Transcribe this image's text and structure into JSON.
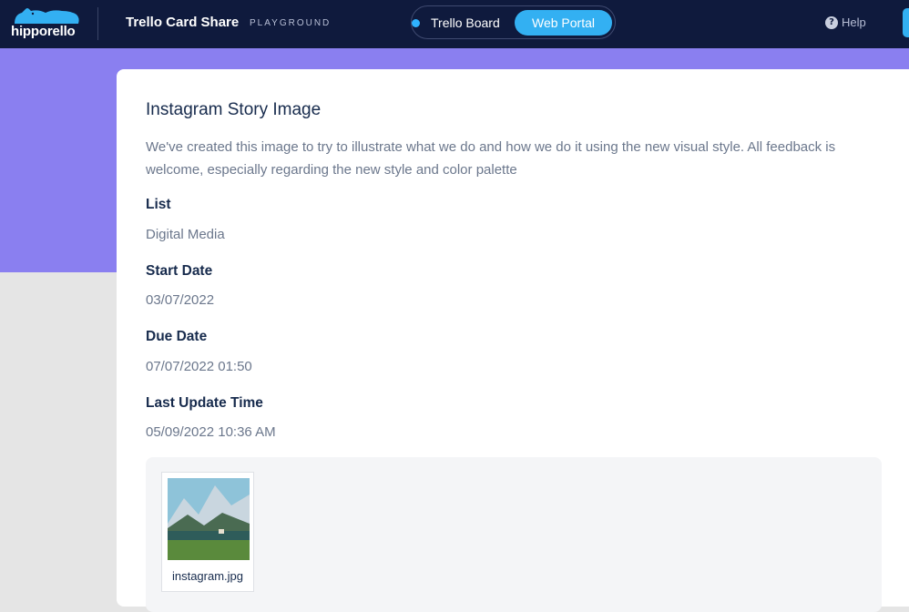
{
  "topbar": {
    "logo_text": "hipporello",
    "app_title": "Trello Card Share",
    "app_subtitle": "PLAYGROUND",
    "toggle": {
      "board_label": "Trello Board",
      "portal_label": "Web Portal",
      "active": "Web Portal"
    },
    "help_label": "Help",
    "icons": {
      "logo": "hippo-logo-icon",
      "help": "help-circle-icon",
      "toggle_dot": "status-dot-icon"
    }
  },
  "card": {
    "title": "Instagram Story Image",
    "description": "We've created this image to try to illustrate what we do and how we do it using the new visual style. All feedback is welcome, especially regarding the new style and color palette",
    "fields": [
      {
        "label": "List",
        "value": "Digital Media"
      },
      {
        "label": "Start Date",
        "value": "03/07/2022"
      },
      {
        "label": "Due Date",
        "value": "07/07/2022 01:50"
      },
      {
        "label": "Last Update Time",
        "value": "05/09/2022 10:36 AM"
      }
    ],
    "attachments": [
      {
        "file_name": "instagram.jpg"
      }
    ]
  },
  "colors": {
    "topbar": "#0f1a3d",
    "accent": "#33b0f2",
    "band": "#8a7ff0",
    "page_background": "#e5e5e5"
  }
}
